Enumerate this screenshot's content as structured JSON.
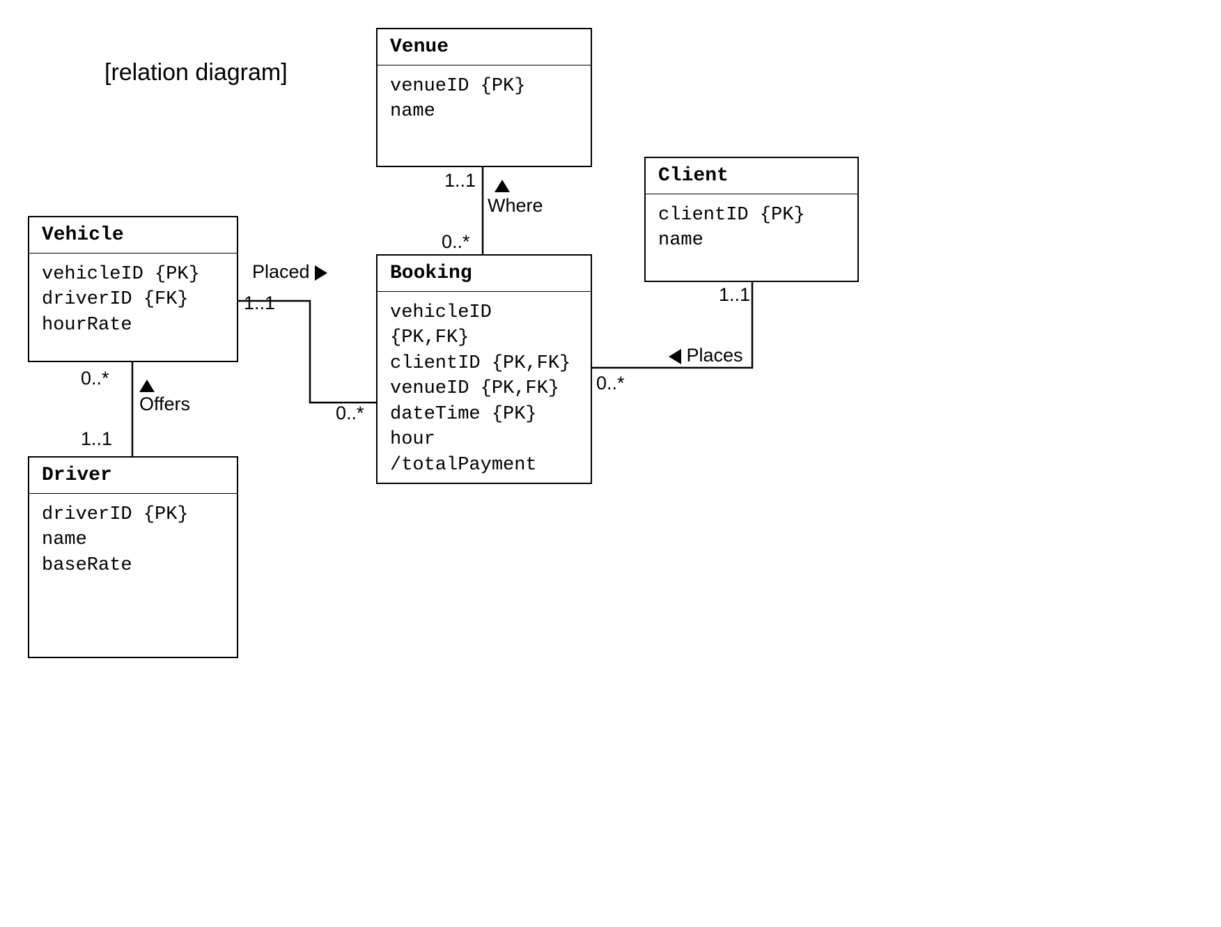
{
  "title": "[relation diagram]",
  "entities": {
    "vehicle": {
      "name": "Vehicle",
      "attrs": [
        "vehicleID {PK}",
        "driverID {FK}",
        "hourRate"
      ]
    },
    "driver": {
      "name": "Driver",
      "attrs": [
        "driverID {PK}",
        "name",
        "baseRate"
      ]
    },
    "venue": {
      "name": "Venue",
      "attrs": [
        "venueID {PK}",
        "name"
      ]
    },
    "booking": {
      "name": "Booking",
      "attrs": [
        "vehicleID {PK,FK}",
        "clientID {PK,FK}",
        "venueID {PK,FK}",
        "dateTime {PK}",
        "hour",
        "/totalPayment"
      ]
    },
    "client": {
      "name": "Client",
      "attrs": [
        "clientID {PK}",
        "name"
      ]
    }
  },
  "relations": {
    "placed": {
      "label": "Placed",
      "vehicle_card": "1..1",
      "booking_card": "0..*"
    },
    "offers": {
      "label": "Offers",
      "vehicle_card": "0..*",
      "driver_card": "1..1"
    },
    "where": {
      "label": "Where",
      "venue_card": "1..1",
      "booking_card": "0..*"
    },
    "places": {
      "label": "Places",
      "booking_card": "0..*",
      "client_card": "1..1"
    }
  }
}
